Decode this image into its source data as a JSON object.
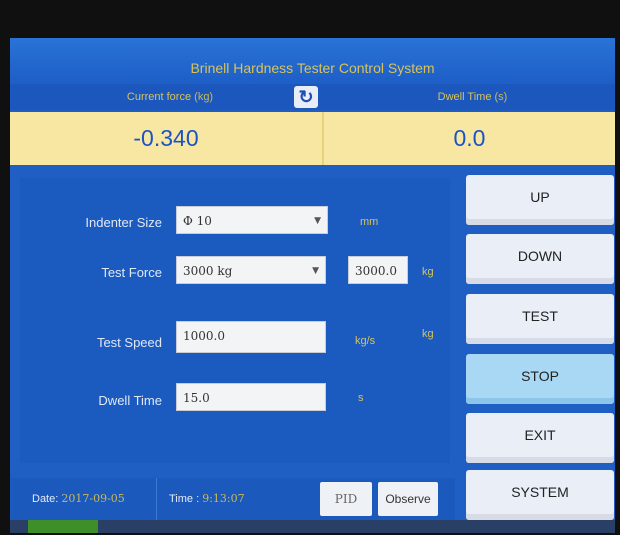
{
  "window": {
    "title": "Brinell Hardness Tester Control System"
  },
  "header": {
    "current_force_label": "Current force",
    "current_force_unit": "(kg)",
    "dwell_time_label": "Dwell Time",
    "dwell_time_unit": "(s)",
    "refresh_glyph": "↻"
  },
  "readouts": {
    "current_force": "-0.340",
    "dwell_time": "0.0"
  },
  "form": {
    "indenter_label": "Indenter Size",
    "indenter_value": "Φ 10",
    "indenter_unit": "mm",
    "test_force_label": "Test Force",
    "test_force_value": "3000 kg",
    "test_force_numeric": "3000.0",
    "test_force_unit": "kg",
    "test_speed_label": "Test Speed",
    "test_speed_value": "1000.0",
    "test_speed_unit": "kg/s",
    "test_speed_unit2": "kg",
    "dwell_label": "Dwell Time",
    "dwell_value": "15.0",
    "dwell_unit": "s"
  },
  "buttons": {
    "up": "UP",
    "down": "DOWN",
    "test": "TEST",
    "stop": "STOP",
    "exit": "EXIT",
    "system": "SYSTEM"
  },
  "footer": {
    "date_label": "Date:",
    "date_value": "2017-09-05",
    "time_label": "Time :",
    "time_value": "9:13:07",
    "pid_label": "PID",
    "observe_label": "Observe"
  }
}
